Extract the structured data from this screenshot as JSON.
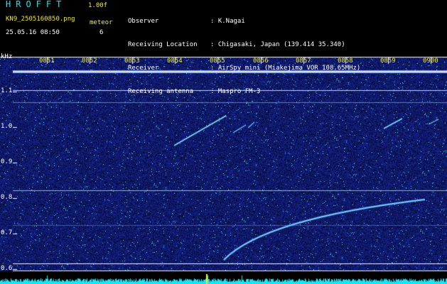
{
  "app": {
    "title": "HROFFT",
    "version": "1.00f",
    "file_name": "KN9_2505160850.png",
    "mode": "meteor",
    "date_time": "25.05.16 08:50",
    "count": "6"
  },
  "meta": {
    "labels": [
      "Observer",
      "Receiving Location",
      "Receiver",
      "Receiving antenna"
    ],
    "values": [
      ": K.Nagai",
      ": Chigasaki, Japan (139.414 35.340)",
      ": AirSpy mini (Miakejima VOR 108.65MHz)",
      ": Maspro FM-3"
    ]
  },
  "axis": {
    "unit": "kHz",
    "time_ticks": [
      "0851",
      "0852",
      "0853",
      "0854",
      "0855",
      "0856",
      "0857",
      "0858",
      "0859",
      "0900"
    ],
    "freq_ticks": [
      "1.1",
      "1.0",
      "0.9",
      "0.8",
      "0.7",
      "0.6"
    ]
  },
  "colors": {
    "background": "#000000",
    "noise": "#1a1fa8",
    "header_cyan": "#12e6ee",
    "header_yellow": "#f2ea2a",
    "carrier": "#9ad6ff",
    "echo": "#7fe0ff"
  }
}
